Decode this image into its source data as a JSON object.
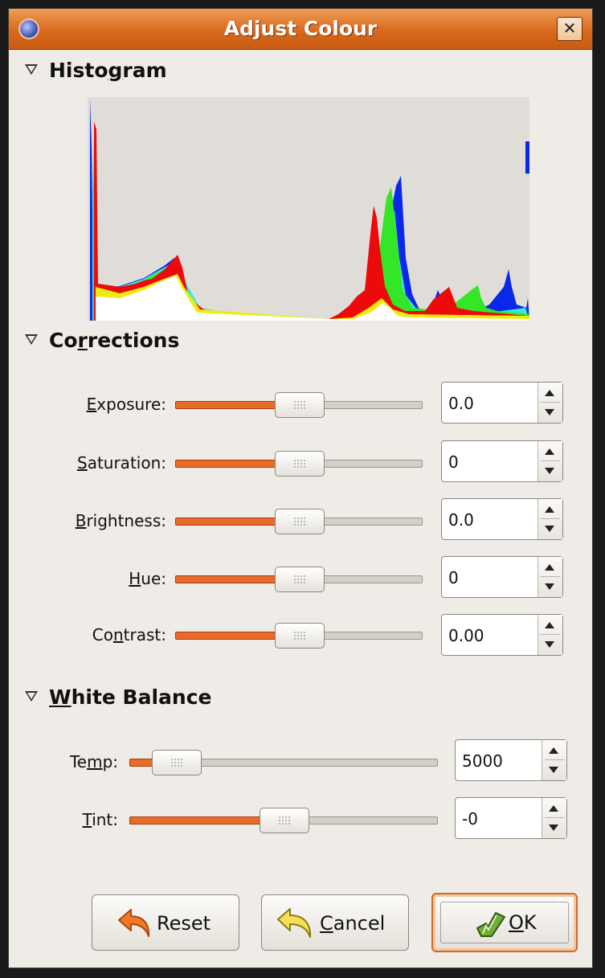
{
  "window": {
    "title": "Adjust Colour"
  },
  "icons": {
    "menu": "window-menu-icon",
    "close": "close-icon",
    "expander": "expander-triangle-icon",
    "reset": "undo-arrow-icon",
    "cancel": "cancel-arrow-icon",
    "ok": "ok-check-icon"
  },
  "colors": {
    "accent": "#ea6a2a",
    "titlebar": "#d86a1e"
  },
  "sections": {
    "histogram": {
      "pre": "Histo",
      "mn": "g",
      "post": "ram"
    },
    "corrections": {
      "pre": "Co",
      "mn": "r",
      "post": "rections"
    },
    "white_balance": {
      "pre": "",
      "mn": "W",
      "post": "hite Balance"
    }
  },
  "corrections": [
    {
      "pre": "",
      "mn": "E",
      "post": "xposure:",
      "value": "0.0",
      "level": 0.5
    },
    {
      "pre": "",
      "mn": "S",
      "post": "aturation:",
      "value": "0",
      "level": 0.5
    },
    {
      "pre": "",
      "mn": "B",
      "post": "rightness:",
      "value": "0.0",
      "level": 0.5
    },
    {
      "pre": "",
      "mn": "H",
      "post": "ue:",
      "value": "0",
      "level": 0.5
    },
    {
      "pre": "Co",
      "mn": "n",
      "post": "trast:",
      "value": "0.00",
      "level": 0.5
    }
  ],
  "white_balance": [
    {
      "pre": "Te",
      "mn": "m",
      "post": "p:",
      "value": "5000",
      "level": 0.15
    },
    {
      "pre": "",
      "mn": "T",
      "post": "int:",
      "value": "-0",
      "level": 0.5
    }
  ],
  "buttons": {
    "reset": {
      "pre": "",
      "mn": "",
      "post": "Reset"
    },
    "cancel": {
      "pre": "",
      "mn": "C",
      "post": "ancel"
    },
    "ok": {
      "pre": "",
      "mn": "O",
      "post": "K"
    }
  }
}
